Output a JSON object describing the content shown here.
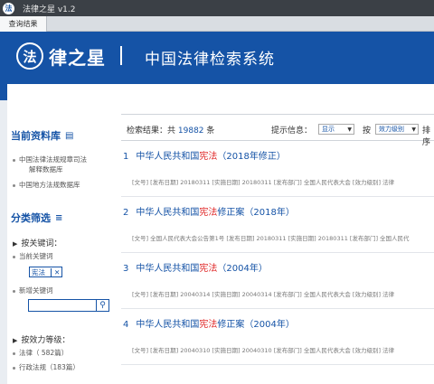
{
  "window": {
    "title": "法律之星 v1.2",
    "app_icon": "法"
  },
  "tabs": [
    {
      "label": "查询结果"
    }
  ],
  "header": {
    "logo_char": "法",
    "logo_text": "律之星",
    "title": "中国法律检索系统"
  },
  "sidebar": {
    "library_title": "当前资料库",
    "libraries": [
      "中国法律法规规章司法",
      "解释数据库",
      "中国地方法规数据库"
    ],
    "filter_title": "分类筛选",
    "keyword_head": "按关键词：",
    "current_keyword_label": "当前关键词",
    "current_keyword": "宪法",
    "new_keyword_label": "新增关键词",
    "new_keyword_value": "",
    "level_head": "按效力等级：",
    "levels": [
      "法律（ 582篇）",
      "行政法规（183篇）"
    ]
  },
  "toolbar": {
    "result_label": "检索结果：共",
    "result_count": "19882",
    "result_unit": "条",
    "hint_label": "提示信息：",
    "hint_select": "显示",
    "by_label": "按",
    "sort_select": "效力级别",
    "sort_label": "排序"
  },
  "results": [
    {
      "num": "1",
      "pre": "中华人民共和国",
      "hl": "宪法",
      "post": "（2018年修正）",
      "meta": "[文号]   [发布日期] 20180311   [实施日期] 20180311   [发布部门] 全国人民代表大会   [效力级别] 法律"
    },
    {
      "num": "2",
      "pre": "中华人民共和国",
      "hl": "宪法",
      "post": "修正案（2018年）",
      "meta": "[文号] 全国人民代表大会公告第1号   [发布日期] 20180311   [实施日期] 20180311   [发布部门] 全国人民代"
    },
    {
      "num": "3",
      "pre": "中华人民共和国",
      "hl": "宪法",
      "post": "（2004年）",
      "meta": "[文号]   [发布日期] 20040314   [实施日期] 20040314   [发布部门] 全国人民代表大会   [效力级别] 法律"
    },
    {
      "num": "4",
      "pre": "中华人民共和国",
      "hl": "宪法",
      "post": "修正案（2004年）",
      "meta": "[文号]   [发布日期] 20040310   [实施日期] 20040310   [发布部门] 全国人民代表大会   [效力级别] 法律"
    }
  ]
}
